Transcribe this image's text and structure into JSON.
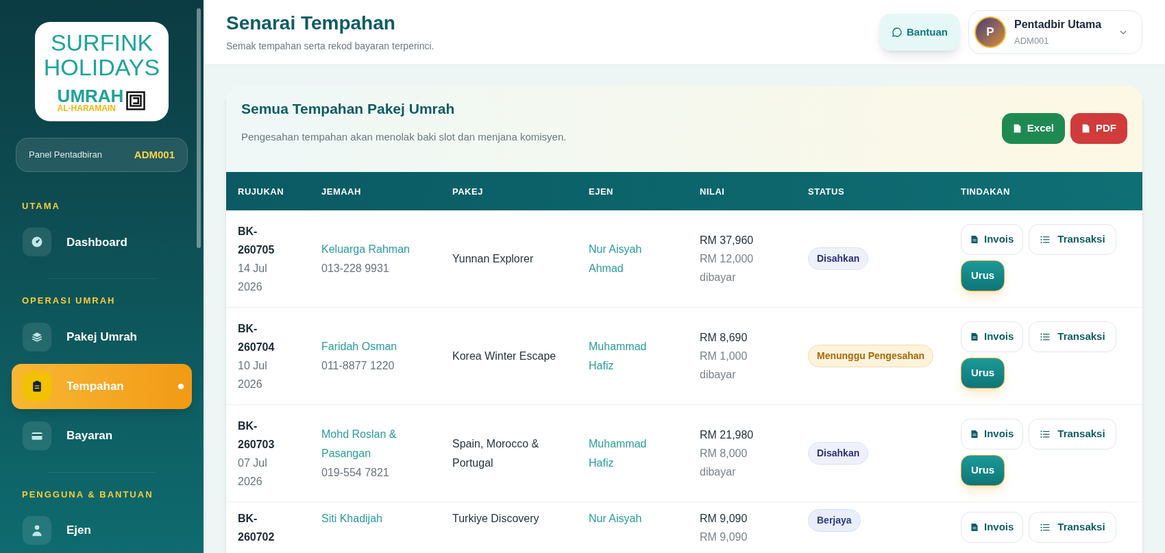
{
  "sidebar": {
    "logo": {
      "line_1": "SURFINK",
      "line_2": "HOLIDAYS",
      "line_3": "UMRAH",
      "line_4": "AL-HARAMAIN"
    },
    "panel": {
      "label": "Panel Pentadbiran",
      "code": "ADM001"
    },
    "sections": [
      {
        "title": "UTAMA",
        "items": [
          {
            "label": "Dashboard",
            "selected": false
          }
        ]
      },
      {
        "title": "OPERASI UMRAH",
        "items": [
          {
            "label": "Pakej Umrah",
            "selected": false
          },
          {
            "label": "Tempahan",
            "selected": true
          },
          {
            "label": "Bayaran",
            "selected": false
          }
        ]
      },
      {
        "title": "PENGGUNA & BANTUAN",
        "items": [
          {
            "label": "Ejen",
            "selected": false
          }
        ]
      }
    ]
  },
  "header": {
    "title": "Senarai Tempahan",
    "subtitle": "Semak tempahan serta rekod bayaran terperinci.",
    "help_button": "Bantuan",
    "user": {
      "initial": "P",
      "name": "Pentadbir Utama",
      "id": "ADM001"
    }
  },
  "card": {
    "title": "Semua Tempahan Pakej Umrah",
    "description": "Pengesahan tempahan akan menolak baki slot dan menjana komisyen.",
    "export_buttons": [
      "Excel",
      "PDF"
    ]
  },
  "table": {
    "columns": [
      "RUJUKAN",
      "JEMAAH",
      "PAKEJ",
      "EJEN",
      "NILAI",
      "STATUS",
      "TINDAKAN"
    ],
    "rows": [
      {
        "ref": "BK-260705",
        "date": "14 Jul 2026",
        "customer": "Keluarga Rahman",
        "phone": "013-228 9931",
        "package": "Yunnan Explorer",
        "agent": "Nur Aisyah Ahmad",
        "total": "RM 37,960",
        "paid": "RM 12,000 dibayar",
        "status": {
          "label": "Disahkan",
          "kind": "confirmed"
        },
        "actions": [
          "Invois",
          "Transaksi",
          "Urus"
        ]
      },
      {
        "ref": "BK-260704",
        "date": "10 Jul 2026",
        "customer": "Faridah Osman",
        "phone": "011-8877 1220",
        "package": "Korea Winter Escape",
        "agent": "Muhammad Hafiz",
        "total": "RM 8,690",
        "paid": "RM 1,000 dibayar",
        "status": {
          "label": "Menunggu Pengesahan",
          "kind": "pending"
        },
        "actions": [
          "Invois",
          "Transaksi",
          "Urus"
        ]
      },
      {
        "ref": "BK-260703",
        "date": "07 Jul 2026",
        "customer": "Mohd Roslan & Pasangan",
        "phone": "019-554 7821",
        "package": "Spain, Morocco & Portugal",
        "agent": "Muhammad Hafiz",
        "total": "RM 21,980",
        "paid": "RM 8,000 dibayar",
        "status": {
          "label": "Disahkan",
          "kind": "confirmed"
        },
        "actions": [
          "Invois",
          "Transaksi",
          "Urus"
        ]
      },
      {
        "ref": "BK-260702",
        "customer": "Siti Khadijah",
        "package": "Turkiye Discovery",
        "agent": "Nur Aisyah",
        "total": "RM 9,090",
        "paid": "RM 9,090",
        "status": {
          "label": "Berjaya",
          "kind": "success"
        },
        "actions": [
          "Invois",
          "Transaksi"
        ]
      }
    ]
  }
}
